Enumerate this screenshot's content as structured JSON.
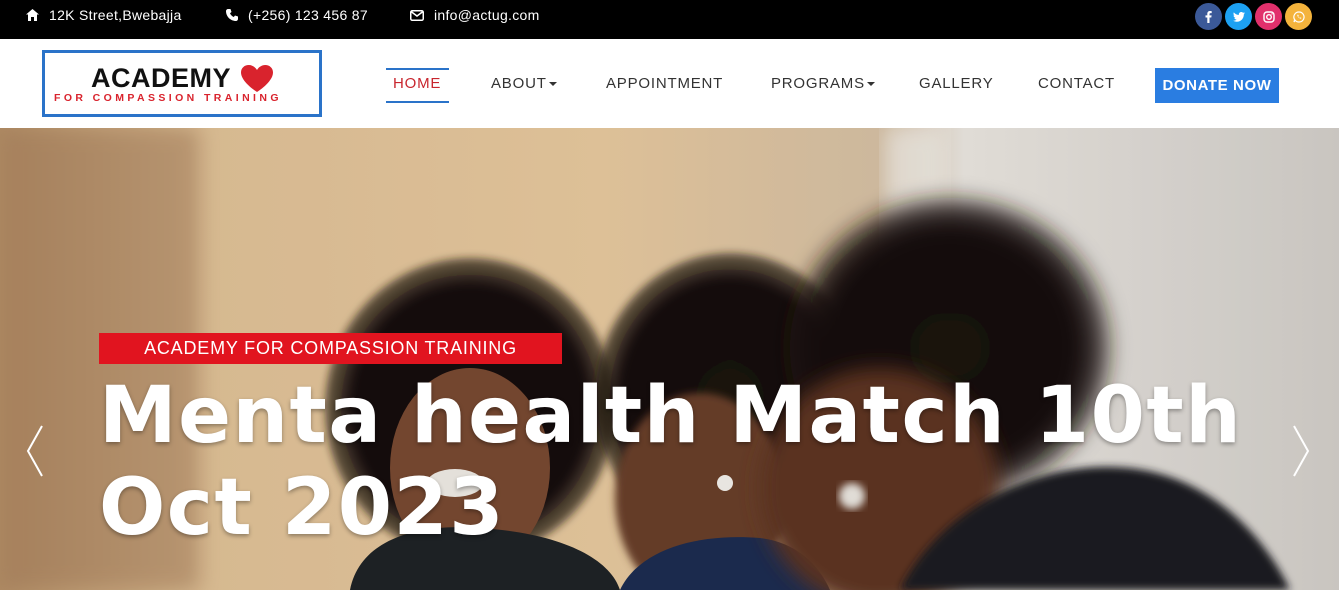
{
  "topbar": {
    "address": "12K Street,Bwebajja",
    "phone": "(+256) 123 456 87",
    "email": "info@actug.com",
    "socials": [
      {
        "name": "facebook",
        "color": "#3b5998"
      },
      {
        "name": "twitter",
        "color": "#1da1f2"
      },
      {
        "name": "instagram",
        "color": "#e1306c"
      },
      {
        "name": "whatsapp",
        "color": "#f4b33c"
      }
    ]
  },
  "logo": {
    "title": "ACADEMY",
    "subtitle": "FOR COMPASSION TRAINING",
    "heart_color": "#d9232d",
    "border_color": "#2a73c9"
  },
  "nav": {
    "home": "HOME",
    "about": "ABOUT",
    "appointment": "APPOINTMENT",
    "programs": "PROGRAMS",
    "gallery": "GALLERY",
    "contact": "CONTACT",
    "donate": "DONATE NOW",
    "active": "HOME",
    "active_color": "#c8262e",
    "accent": "#2a7de1"
  },
  "hero": {
    "eyebrow": "ACADEMY FOR COMPASSION TRAINING",
    "headline_line1": "Menta health Match 10th",
    "headline_line2": "Oct 2023",
    "eyebrow_color": "#e1141f"
  }
}
